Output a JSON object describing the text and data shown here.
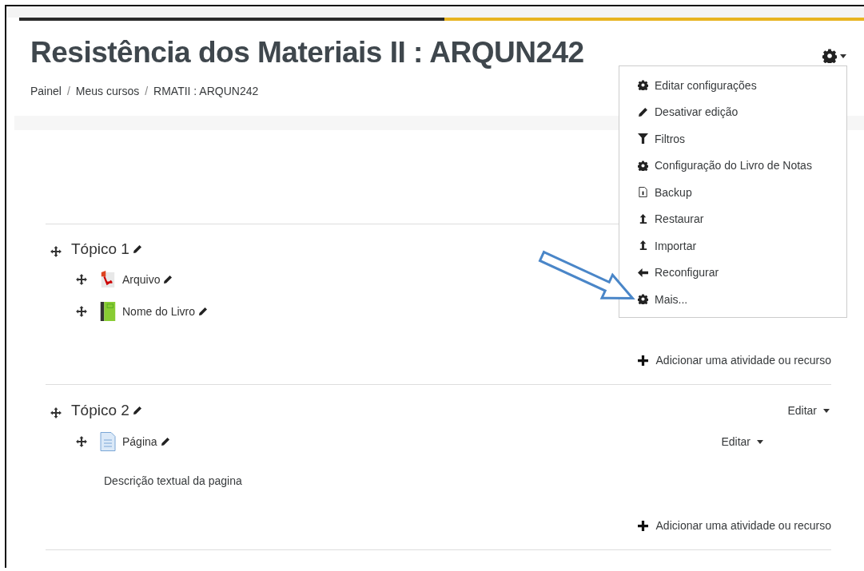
{
  "course": {
    "title": "Resistência dos Materiais II : ARQUN242"
  },
  "breadcrumb": [
    "Painel",
    "Meus cursos",
    "RMATII : ARQUN242"
  ],
  "breadcrumb_separator": "/",
  "settings_menu": {
    "items": [
      {
        "kind": "gear",
        "label": "Editar configurações"
      },
      {
        "kind": "pencil",
        "label": "Desativar edição"
      },
      {
        "kind": "filter",
        "label": "Filtros"
      },
      {
        "kind": "gear",
        "label": "Configuração do Livro de Notas"
      },
      {
        "kind": "backup",
        "label": "Backup"
      },
      {
        "kind": "upload",
        "label": "Restaurar"
      },
      {
        "kind": "upload",
        "label": "Importar"
      },
      {
        "kind": "arrow",
        "label": "Reconfigurar"
      },
      {
        "kind": "gear",
        "label": "Mais..."
      }
    ]
  },
  "sections": [
    {
      "title": "Tópico 1",
      "activities": [
        {
          "kind": "pdf",
          "name": "Arquivo"
        },
        {
          "kind": "book",
          "name": "Nome do Livro"
        }
      ],
      "add_link": "Adicionar uma atividade ou recurso"
    },
    {
      "title": "Tópico 2",
      "edit_menu": "Editar",
      "activities": [
        {
          "kind": "page",
          "name": "Página",
          "edit_menu": "Editar",
          "description": "Descrição textual da pagina"
        }
      ],
      "add_link": "Adicionar uma atividade ou recurso"
    }
  ]
}
